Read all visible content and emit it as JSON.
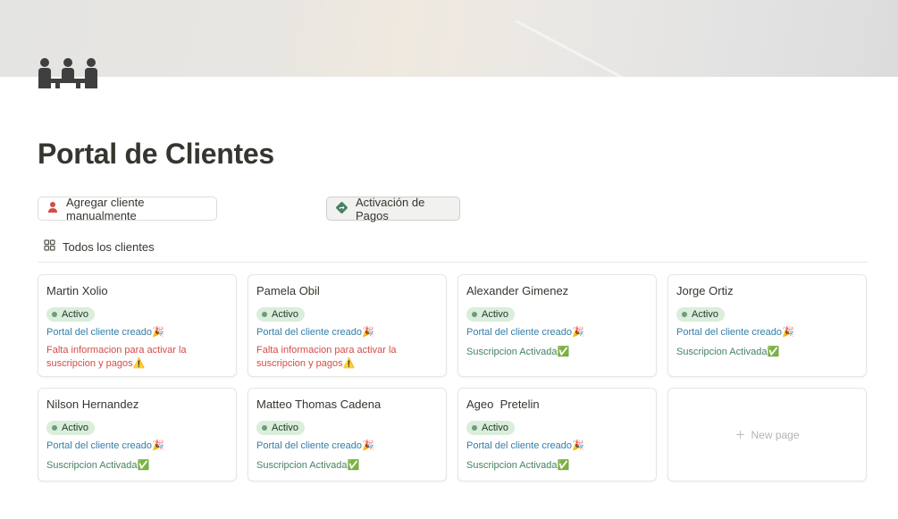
{
  "page": {
    "icon": "team-meeting-icon",
    "title": "Portal de Clientes"
  },
  "buttons": {
    "add_client": {
      "label": "Agregar cliente manualmente",
      "icon": "person-icon"
    },
    "activate_payments": {
      "label": "Activación de Pagos",
      "icon": "direction-sign-icon"
    }
  },
  "view": {
    "label": "Todos los clientes",
    "icon": "gallery-grid-icon"
  },
  "status_label": "Activo",
  "cards": [
    {
      "name": "Martin Xolio",
      "status": "Activo",
      "portal": "Portal del cliente creado🎉",
      "info": "Falta informacion para activar la suscripcion y pagos⚠️",
      "info_type": "warning"
    },
    {
      "name": "Pamela Obil",
      "status": "Activo",
      "portal": "Portal del cliente creado🎉",
      "info": "Falta informacion para activar la suscripcion y pagos⚠️",
      "info_type": "warning"
    },
    {
      "name": "Alexander Gimenez",
      "status": "Activo",
      "portal": "Portal del cliente creado🎉",
      "info": "Suscripcion Activada✅",
      "info_type": "ok"
    },
    {
      "name": "Jorge Ortiz",
      "status": "Activo",
      "portal": "Portal del cliente creado🎉",
      "info": "Suscripcion Activada✅",
      "info_type": "ok"
    },
    {
      "name": "Nilson Hernandez",
      "status": "Activo",
      "portal": "Portal del cliente creado🎉",
      "info": "Suscripcion Activada✅",
      "info_type": "ok"
    },
    {
      "name": "Matteo Thomas Cadena",
      "status": "Activo",
      "portal": "Portal del cliente creado🎉",
      "info": "Suscripcion Activada✅",
      "info_type": "ok"
    },
    {
      "name": "Ageo  Pretelin",
      "status": "Activo",
      "portal": "Portal del cliente creado🎉",
      "info": "Suscripcion Activada✅",
      "info_type": "ok"
    }
  ],
  "new_page": {
    "label": "New page",
    "icon": "plus-icon"
  },
  "colors": {
    "portal_text": "#337ea9",
    "warning_text": "#d44c47",
    "ok_text": "#448361",
    "status_badge_bg": "#dbeddb"
  }
}
